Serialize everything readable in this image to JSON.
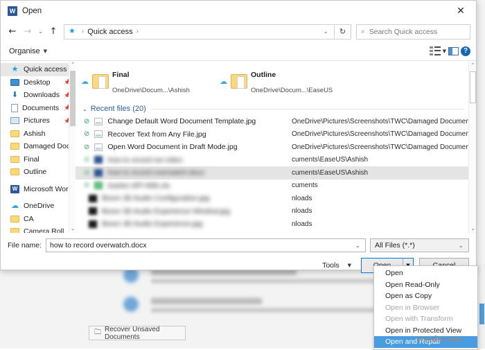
{
  "dialog": {
    "title": "Open",
    "app_icon": "W",
    "close_label": "✕"
  },
  "address": {
    "back": "←",
    "forward": "→",
    "history": "⌄",
    "up": "↑",
    "star_icon": "★",
    "crumb": "Quick access",
    "sep": "›",
    "chevron": "⌄",
    "refresh": "↻"
  },
  "search": {
    "icon": "⌕",
    "placeholder": "Search Quick access"
  },
  "toolbar": {
    "organise": "Organise",
    "caret": "▼",
    "view_caret": "▼",
    "help": "?"
  },
  "sidebar": {
    "items": [
      {
        "label": "Quick access",
        "icon": "star",
        "pin": "",
        "selected": true
      },
      {
        "label": "Desktop",
        "icon": "desktop",
        "pin": "📌",
        "selected": false
      },
      {
        "label": "Downloads",
        "icon": "down",
        "pin": "📌",
        "selected": false
      },
      {
        "label": "Documents",
        "icon": "doc",
        "pin": "📌",
        "selected": false
      },
      {
        "label": "Pictures",
        "icon": "pic",
        "pin": "📌",
        "selected": false
      },
      {
        "label": "Ashish",
        "icon": "folder",
        "pin": "",
        "selected": false
      },
      {
        "label": "Damaged Docur",
        "icon": "folder",
        "pin": "",
        "selected": false
      },
      {
        "label": "Final",
        "icon": "folder",
        "pin": "",
        "selected": false
      },
      {
        "label": "Outline",
        "icon": "folder",
        "pin": "",
        "selected": false
      },
      {
        "label": "Microsoft Word",
        "icon": "wordapp",
        "pin": "",
        "selected": false
      },
      {
        "label": "OneDrive",
        "icon": "cloud",
        "pin": "",
        "selected": false
      },
      {
        "label": "CA",
        "icon": "folder",
        "pin": "",
        "selected": false
      },
      {
        "label": "Camera Roll",
        "icon": "folder",
        "pin": "",
        "selected": false
      }
    ],
    "scroll_up": "⌃",
    "scroll_down": "⌄"
  },
  "frequent_folders": [
    {
      "name": "Final",
      "path": "OneDrive\\Docum...\\Ashish"
    },
    {
      "name": "Outline",
      "path": "OneDrive\\Docum...\\EaseUS"
    }
  ],
  "recent": {
    "chevron": "⌄",
    "header": "Recent files (20)",
    "rows": [
      {
        "name": "Change Default Word Document Template.jpg",
        "path": "OneDrive\\Pictures\\Screenshots\\TWC\\Damaged Document",
        "icon": "img",
        "check": "⊘",
        "blurred": false,
        "highlighted": false
      },
      {
        "name": "Recover Text from Any File.jpg",
        "path": "OneDrive\\Pictures\\Screenshots\\TWC\\Damaged Document",
        "icon": "img",
        "check": "⊘",
        "blurred": false,
        "highlighted": false
      },
      {
        "name": "Open Word Document in Draft Mode.jpg",
        "path": "OneDrive\\Pictures\\Screenshots\\TWC\\Damaged Document",
        "icon": "img",
        "check": "⊘",
        "blurred": false,
        "highlighted": false
      },
      {
        "name": "how to record ow video",
        "path": "cuments\\EaseUS\\Ashish",
        "icon": "wd",
        "check": "⊘",
        "blurred": true,
        "highlighted": false
      },
      {
        "name": "how to record overwatch.docx",
        "path": "cuments\\EaseUS\\Ashish",
        "icon": "wd",
        "check": "⊘",
        "blurred": true,
        "highlighted": true
      },
      {
        "name": "tracker API Wiki.xls",
        "path": "cuments",
        "icon": "grn",
        "check": "⊘",
        "blurred": true,
        "highlighted": false
      },
      {
        "name": "Boom 3D Audio Configuration.jpg",
        "path": "nloads",
        "icon": "blk",
        "check": "",
        "blurred": true,
        "highlighted": false
      },
      {
        "name": "Boom 3D Audio Experience Window.jpg",
        "path": "nloads",
        "icon": "blk",
        "check": "",
        "blurred": true,
        "highlighted": false
      },
      {
        "name": "Boom 3D Audio Experience.jpg",
        "path": "nloads",
        "icon": "blk",
        "check": "",
        "blurred": true,
        "highlighted": false
      }
    ],
    "scroll_up": "⌃",
    "scroll_down": "⌄"
  },
  "form": {
    "file_name_label": "File name:",
    "file_name_value": "how to record overwatch.docx",
    "file_name_chevron": "⌄",
    "file_type_value": "All Files (*.*)",
    "file_type_chevron": "⌄",
    "tools_label": "Tools",
    "tools_caret": "▼",
    "open_label": "Open",
    "open_caret": "▼",
    "cancel_label": "Cancel"
  },
  "open_menu": {
    "items": [
      {
        "label": "Open",
        "disabled": false,
        "selected": false
      },
      {
        "label": "Open Read-Only",
        "disabled": false,
        "selected": false
      },
      {
        "label": "Open as Copy",
        "disabled": false,
        "selected": false
      },
      {
        "label": "Open in Browser",
        "disabled": true,
        "selected": false
      },
      {
        "label": "Open with Transform",
        "disabled": true,
        "selected": false
      },
      {
        "label": "Open in Protected View",
        "disabled": false,
        "selected": false
      },
      {
        "label": "Open and Repair",
        "disabled": false,
        "selected": true
      }
    ]
  },
  "background": {
    "recover_button": "Recover Unsaved Documents",
    "recover_icon": "🗀"
  },
  "watermark": {
    "text": "wsxdn.com"
  },
  "colors": {
    "accent": "#0078d7",
    "menu_highlight": "#4a9ce0",
    "word_blue": "#2b579a",
    "link_blue": "#2b5f9e"
  }
}
